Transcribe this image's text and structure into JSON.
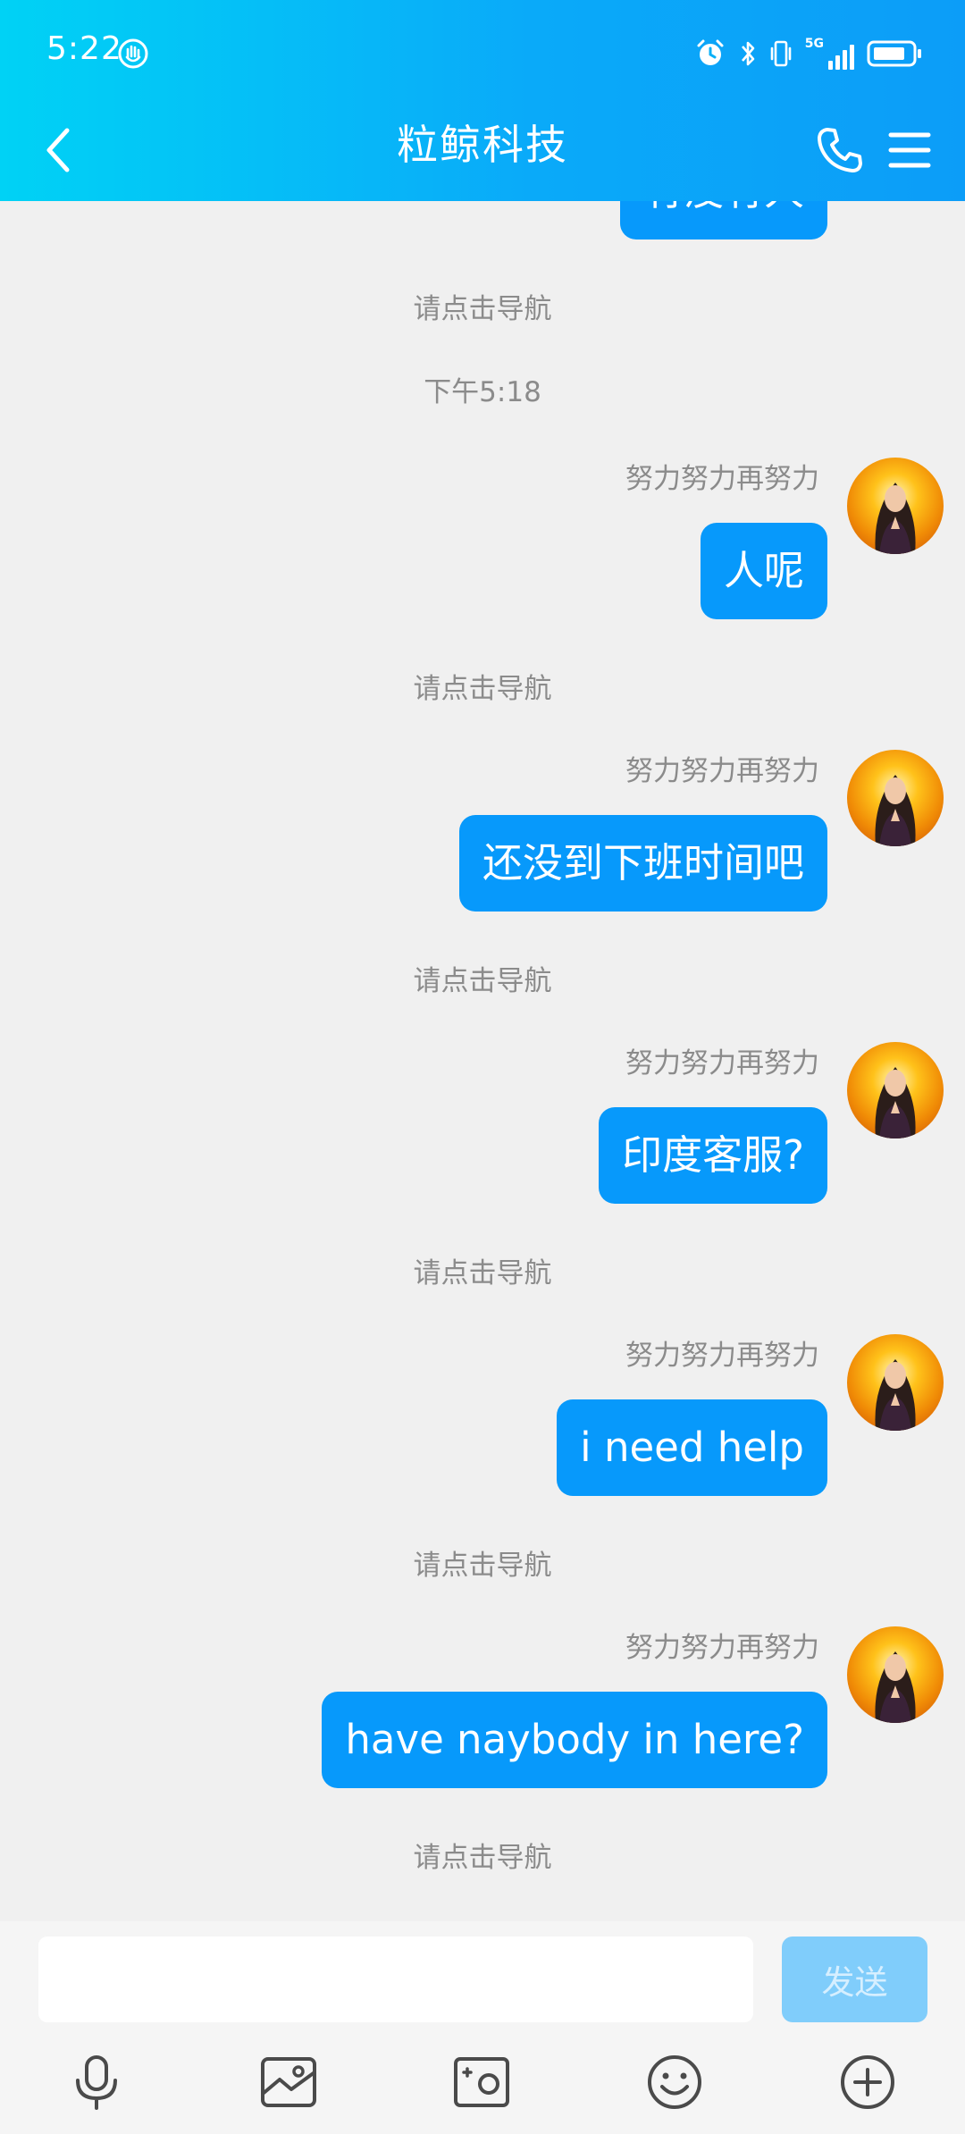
{
  "status_bar": {
    "time": "5:22",
    "network": "5G"
  },
  "header": {
    "title": "粒鲸科技"
  },
  "messages": {
    "clipped_bubble_text": "有没有人",
    "nav_prompt": "请点击导航",
    "timestamp": "下午5:18",
    "sender": "努力努力再努力",
    "bubbles": [
      "人呢",
      "还没到下班时间吧",
      "印度客服?",
      "i need help",
      "have naybody in here?"
    ]
  },
  "composer": {
    "input_value": "",
    "send_label": "发送"
  },
  "toolbar": {
    "icons": [
      "microphone-icon",
      "image-icon",
      "camera-icon",
      "emoji-icon",
      "plus-icon"
    ]
  },
  "colors": {
    "header_start": "#00d2f5",
    "header_end": "#0c9df8",
    "bubble": "#0799fb",
    "send_disabled": "#80cdfb",
    "background": "#f0f0f0"
  }
}
